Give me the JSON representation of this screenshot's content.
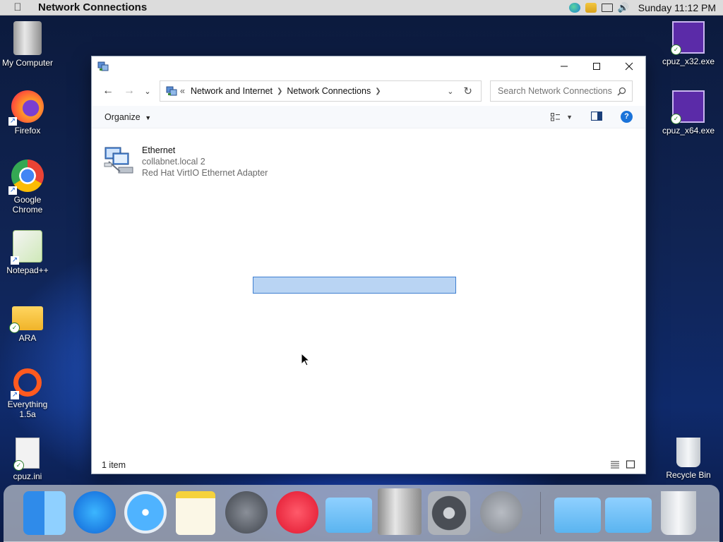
{
  "menubar": {
    "window_title": "Network Connections",
    "clock": "Sunday 11:12 PM"
  },
  "desktop": {
    "icons": [
      {
        "label": "My Computer"
      },
      {
        "label": "Firefox"
      },
      {
        "label": "Google Chrome"
      },
      {
        "label": "Notepad++"
      },
      {
        "label": "ARA"
      },
      {
        "label": "Everything 1.5a"
      },
      {
        "label": "cpuz.ini"
      },
      {
        "label": "cpuz_x32.exe"
      },
      {
        "label": "cpuz_x64.exe"
      },
      {
        "label": "Recycle Bin"
      }
    ]
  },
  "explorer": {
    "breadcrumb": {
      "overflow": "«",
      "segments": [
        "Network and Internet",
        "Network Connections"
      ]
    },
    "search_placeholder": "Search Network Connections",
    "organize_label": "Organize",
    "items": [
      {
        "name": "Ethernet",
        "network": "collabnet.local 2",
        "adapter": "Red Hat VirtIO Ethernet Adapter"
      }
    ],
    "status": "1 item",
    "colors": {
      "accent": "#1a73d9",
      "selection_fill": "#b9d4f3",
      "selection_border": "#3f7fd0"
    }
  },
  "dock": {
    "apps": [
      "finder-icon",
      "app-store-icon",
      "safari-icon",
      "notes-icon",
      "launchpad-icon",
      "music-icon",
      "folder-icon",
      "mac-pro-icon",
      "system-preferences-icon",
      "power-icon",
      "folder-icon",
      "folder-icon",
      "trash-icon"
    ]
  }
}
